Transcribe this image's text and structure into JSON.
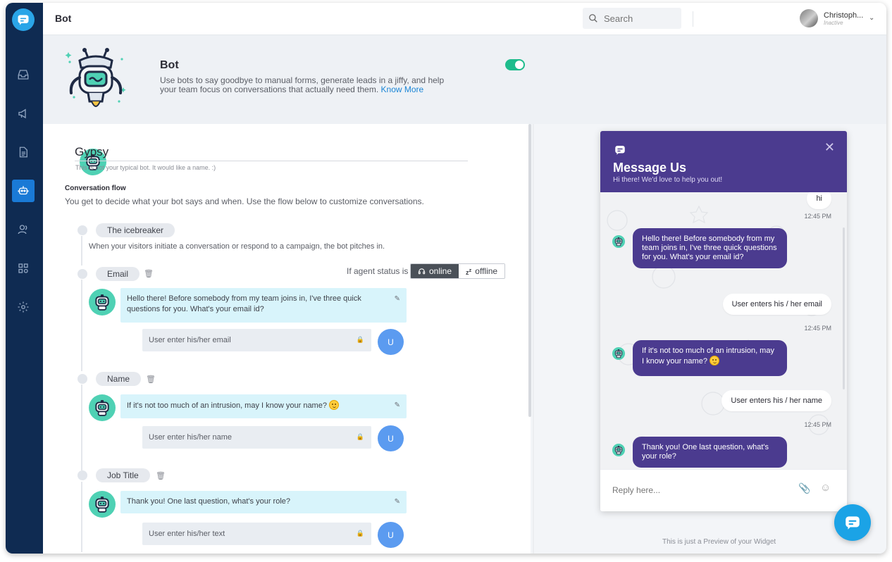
{
  "header": {
    "title": "Bot",
    "search_placeholder": "Search",
    "user_name": "Christoph...",
    "user_status": "Inactive"
  },
  "banner": {
    "title": "Bot",
    "description": "Use bots to say goodbye to manual forms, generate leads in a jiffy, and help your team focus on conversations that actually need them.",
    "link": "Know More",
    "enabled": true
  },
  "bot": {
    "name": "Gypsy",
    "name_hint": "This is not your typical bot. It would like a name. :)"
  },
  "flow": {
    "title": "Conversation flow",
    "description": "You get to decide what your bot says and when. Use the flow below to customize conversations.",
    "icebreaker": {
      "label": "The icebreaker",
      "description": "When your visitors initiate a conversation or respond to a campaign, the bot pitches in."
    },
    "agent_status_label": "If agent status is",
    "status_online": "online",
    "status_offline": "offline",
    "user_avatar": "U",
    "steps": [
      {
        "label": "Email",
        "message": "Hello there! Before somebody from my team joins in, I've three quick questions for you. What's your email id?",
        "input": "User enter his/her email"
      },
      {
        "label": "Name",
        "message": "If it's not too much of an intrusion, may I know your name?",
        "input": "User enter his/her name"
      },
      {
        "label": "Job Title",
        "message": "Thank you! One last question, what's your role?",
        "input": "User enter his/her text"
      }
    ]
  },
  "widget": {
    "title": "Message Us",
    "subtitle": "Hi there! We'd love to help you out!",
    "reply_placeholder": "Reply here...",
    "preview_note": "This is just a Preview of your Widget",
    "messages": {
      "m1_user": "hi",
      "t1": "12:45 PM",
      "m2_bot": "Hello there! Before somebody from my team joins in, I've three quick questions for you. What's your email id?",
      "m3_user": "User enters his / her email",
      "t2": "12:45 PM",
      "m4_bot": "If it's not too much of an intrusion, may I know your name?",
      "m5_user": "User enters his / her name",
      "t3": "12:45 PM",
      "m6_bot": "Thank you! One last question, what's your role?"
    }
  },
  "colors": {
    "sidebar": "#0f2b52",
    "accent": "#1a7ad6",
    "widget_header": "#4b3b8f",
    "toggle_on": "#1ebc8c",
    "bot_message_bg": "#d8f4fb"
  }
}
